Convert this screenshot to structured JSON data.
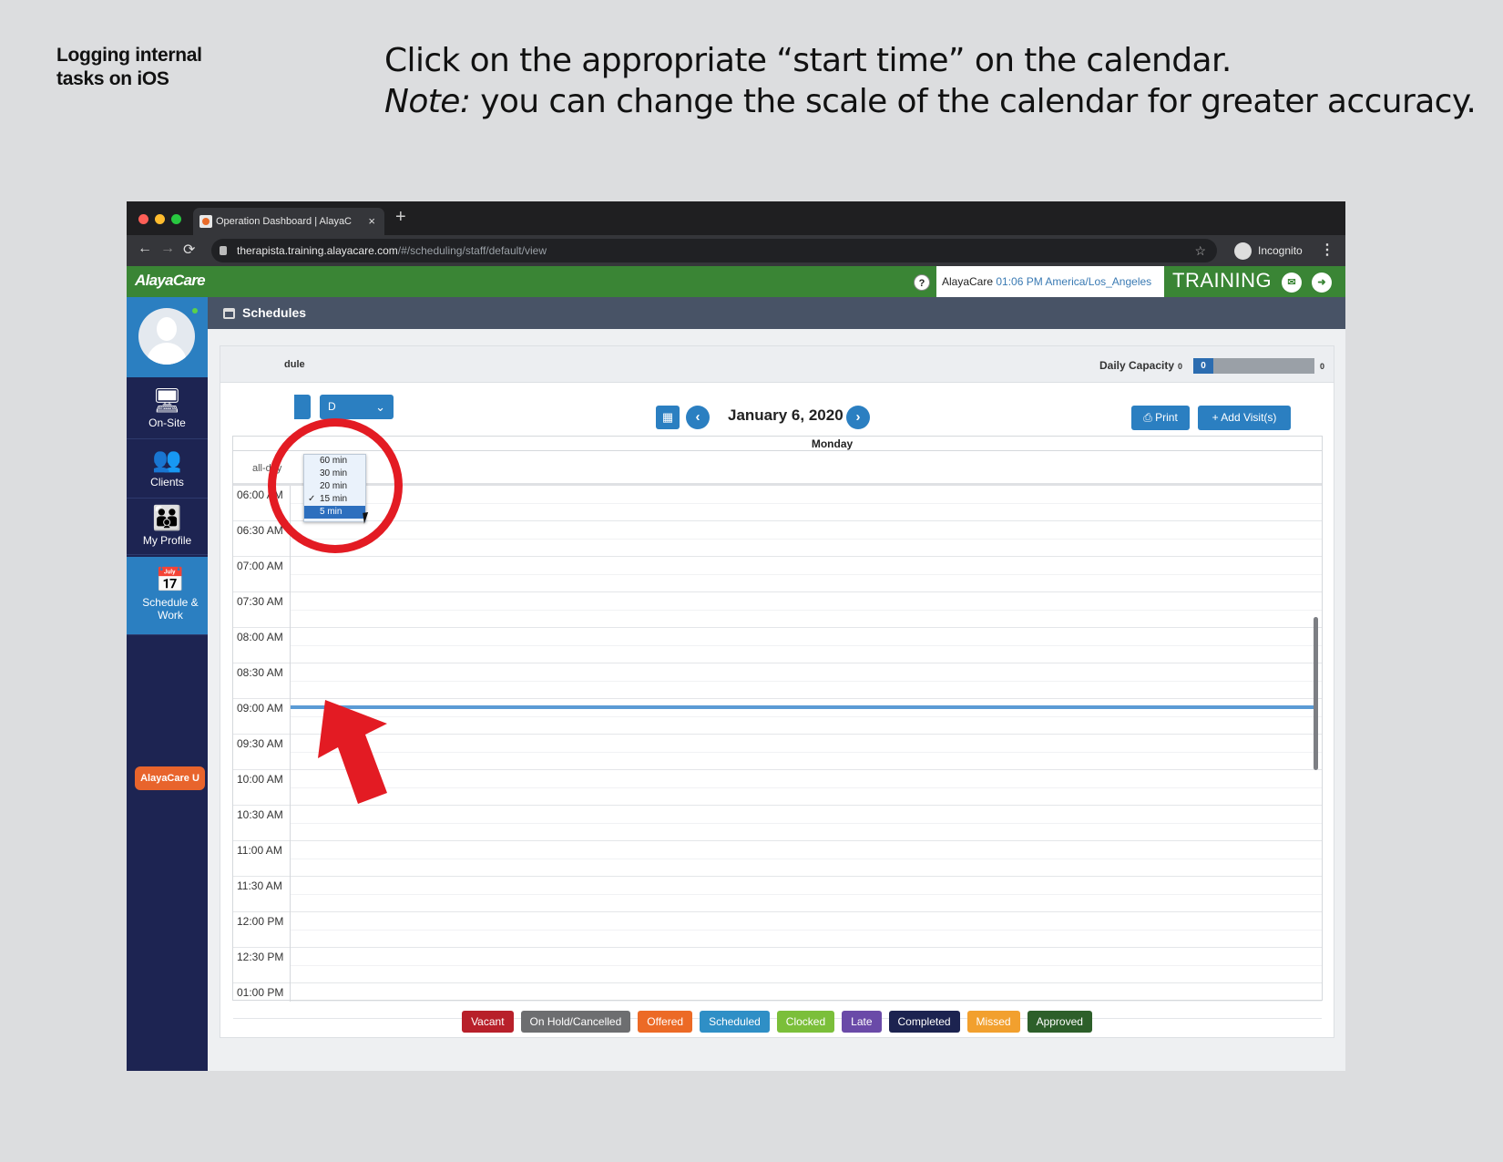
{
  "slide": {
    "title_line1": "Logging internal",
    "title_line2": "tasks on iOS",
    "instruction_line1": "Click on the appropriate “start time” on the calendar.",
    "note_label": "Note:",
    "note_text": " you can change the scale of the calendar for greater accuracy."
  },
  "browser": {
    "tab_title": "Operation Dashboard | AlayaC",
    "tab_close": "×",
    "new_tab": "+",
    "url_host": "therapista.training.alayacare.com",
    "url_path": "/#/scheduling/staff/default/view",
    "incognito": "Incognito",
    "back": "←",
    "forward": "→",
    "reload": "⟳",
    "star": "☆",
    "menu": "⋮"
  },
  "appbar": {
    "logo": "AlayaCare",
    "help": "?",
    "user_name": "AlayaCare",
    "time": "01:06 PM",
    "timezone": "America/Los_Angeles",
    "env_label": "TRAINING"
  },
  "sidebar": {
    "items": [
      {
        "label": "On-Site",
        "icon": "monitor-icon"
      },
      {
        "label": "Clients",
        "icon": "clients-icon"
      },
      {
        "label": "My Profile",
        "icon": "team-icon"
      },
      {
        "label": "Schedule & Work",
        "icon": "calendar-icon",
        "active": true
      }
    ],
    "alayacare_u": "AlayaCare U"
  },
  "schedules": {
    "header": "Schedules",
    "panel_title_fragment": "dule",
    "daily_capacity_label": "Daily Capacity",
    "capacity_min": "0",
    "capacity_value": "0",
    "capacity_max": "0",
    "capacity_fill_fraction": 0.0,
    "view_dropdown_fragment": "D",
    "date": "January 6, 2020",
    "print": "Print",
    "add_visit": "+ Add Visit(s)",
    "day_name": "Monday",
    "all_day": "all-day",
    "current_time_line": "09:00 AM"
  },
  "scale_menu": {
    "options": [
      "60 min",
      "30 min",
      "20 min",
      "15 min",
      "5 min"
    ],
    "checked": "15 min",
    "highlighted": "5 min"
  },
  "time_slots": [
    "06:00 AM",
    "06:30 AM",
    "07:00 AM",
    "07:30 AM",
    "08:00 AM",
    "08:30 AM",
    "09:00 AM",
    "09:30 AM",
    "10:00 AM",
    "10:30 AM",
    "11:00 AM",
    "11:30 AM",
    "12:00 PM",
    "12:30 PM",
    "01:00 PM"
  ],
  "legend": [
    {
      "label": "Vacant",
      "color": "#b8202a"
    },
    {
      "label": "On Hold/Cancelled",
      "color": "#6d6e70"
    },
    {
      "label": "Offered",
      "color": "#ec6a26"
    },
    {
      "label": "Scheduled",
      "color": "#2f8fc6"
    },
    {
      "label": "Clocked",
      "color": "#7bbf3a"
    },
    {
      "label": "Late",
      "color": "#6a4aa8"
    },
    {
      "label": "Completed",
      "color": "#1c2350"
    },
    {
      "label": "Missed",
      "color": "#f2a02e"
    },
    {
      "label": "Approved",
      "color": "#2d5f2a"
    }
  ],
  "colors": {
    "appbar_green": "#3a8535",
    "sidebar_navy": "#1d2452",
    "accent_blue": "#2b7fc1",
    "highlight_red": "#e31b23"
  }
}
